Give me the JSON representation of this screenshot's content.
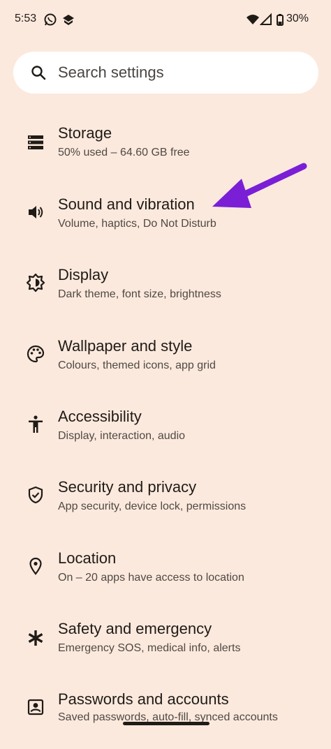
{
  "status_bar": {
    "time": "5:53",
    "battery_percent": "30%",
    "icons": [
      "whatsapp-icon",
      "app-notification-icon",
      "wifi-icon",
      "signal-icon",
      "battery-icon"
    ]
  },
  "search": {
    "placeholder": "Search settings"
  },
  "settings": [
    {
      "icon": "storage-icon",
      "title": "Storage",
      "subtitle": "50% used – 64.60 GB free"
    },
    {
      "icon": "volume-icon",
      "title": "Sound and vibration",
      "subtitle": "Volume, haptics, Do Not Disturb"
    },
    {
      "icon": "brightness-icon",
      "title": "Display",
      "subtitle": "Dark theme, font size, brightness"
    },
    {
      "icon": "palette-icon",
      "title": "Wallpaper and style",
      "subtitle": "Colours, themed icons, app grid"
    },
    {
      "icon": "accessibility-icon",
      "title": "Accessibility",
      "subtitle": "Display, interaction, audio"
    },
    {
      "icon": "shield-icon",
      "title": "Security and privacy",
      "subtitle": "App security, device lock, permissions"
    },
    {
      "icon": "location-pin-icon",
      "title": "Location",
      "subtitle": "On – 20 apps have access to location"
    },
    {
      "icon": "asterisk-icon",
      "title": "Safety and emergency",
      "subtitle": "Emergency SOS, medical info, alerts"
    },
    {
      "icon": "account-box-icon",
      "title": "Passwords and accounts",
      "subtitle": "Saved passwords, auto-fill, synced accounts"
    }
  ],
  "colors": {
    "background": "#fce9dd",
    "arrow": "#7a1fd6",
    "text": "#1f1b16"
  }
}
